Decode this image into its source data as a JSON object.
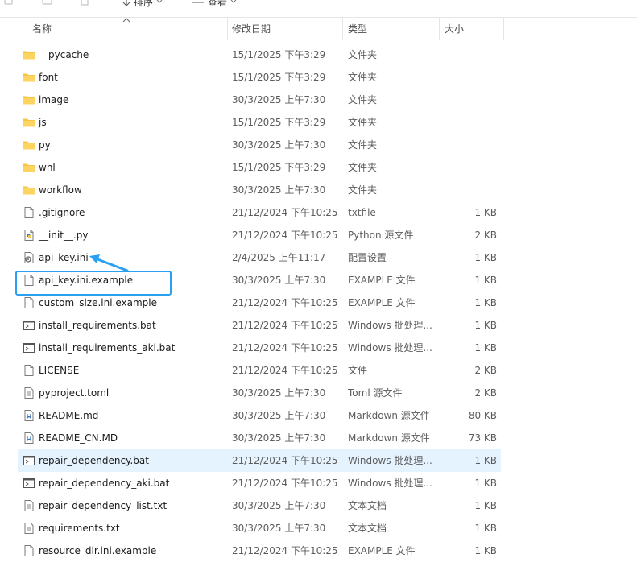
{
  "toolbar": {
    "sort_label": "排序",
    "view_label": "查看",
    "more_label": "···"
  },
  "columns": {
    "name": "名称",
    "date": "修改日期",
    "type": "类型",
    "size": "大小"
  },
  "colors": {
    "folder": "#f8c542",
    "selected_row": "#e5f3ff",
    "annotation": "#2aa0f0"
  },
  "files": [
    {
      "name": "__pycache__",
      "date": "15/1/2025 下午3:29",
      "type": "文件夹",
      "size": "",
      "icon": "folder-icon"
    },
    {
      "name": "font",
      "date": "15/1/2025 下午3:29",
      "type": "文件夹",
      "size": "",
      "icon": "folder-icon"
    },
    {
      "name": "image",
      "date": "30/3/2025 上午7:30",
      "type": "文件夹",
      "size": "",
      "icon": "folder-icon"
    },
    {
      "name": "js",
      "date": "15/1/2025 下午3:29",
      "type": "文件夹",
      "size": "",
      "icon": "folder-icon"
    },
    {
      "name": "py",
      "date": "30/3/2025 上午7:30",
      "type": "文件夹",
      "size": "",
      "icon": "folder-icon"
    },
    {
      "name": "whl",
      "date": "15/1/2025 下午3:29",
      "type": "文件夹",
      "size": "",
      "icon": "folder-icon"
    },
    {
      "name": "workflow",
      "date": "30/3/2025 上午7:30",
      "type": "文件夹",
      "size": "",
      "icon": "folder-icon"
    },
    {
      "name": ".gitignore",
      "date": "21/12/2024 下午10:25",
      "type": "txtfile",
      "size": "1 KB",
      "icon": "blank-file-icon"
    },
    {
      "name": "__init__.py",
      "date": "21/12/2024 下午10:25",
      "type": "Python 源文件",
      "size": "2 KB",
      "icon": "python-file-icon"
    },
    {
      "name": "api_key.ini",
      "date": "2/4/2025 上午11:17",
      "type": "配置设置",
      "size": "1 KB",
      "icon": "config-file-icon"
    },
    {
      "name": "api_key.ini.example",
      "date": "30/3/2025 上午7:30",
      "type": "EXAMPLE 文件",
      "size": "1 KB",
      "icon": "blank-file-icon"
    },
    {
      "name": "custom_size.ini.example",
      "date": "21/12/2024 下午10:25",
      "type": "EXAMPLE 文件",
      "size": "1 KB",
      "icon": "blank-file-icon"
    },
    {
      "name": "install_requirements.bat",
      "date": "21/12/2024 下午10:25",
      "type": "Windows 批处理...",
      "size": "1 KB",
      "icon": "batch-file-icon"
    },
    {
      "name": "install_requirements_aki.bat",
      "date": "21/12/2024 下午10:25",
      "type": "Windows 批处理...",
      "size": "1 KB",
      "icon": "batch-file-icon"
    },
    {
      "name": "LICENSE",
      "date": "21/12/2024 下午10:25",
      "type": "文件",
      "size": "2 KB",
      "icon": "blank-file-icon"
    },
    {
      "name": "pyproject.toml",
      "date": "30/3/2025 上午7:30",
      "type": "Toml 源文件",
      "size": "2 KB",
      "icon": "text-file-icon"
    },
    {
      "name": "README.md",
      "date": "30/3/2025 上午7:30",
      "type": "Markdown 源文件",
      "size": "80 KB",
      "icon": "markdown-file-icon"
    },
    {
      "name": "README_CN.MD",
      "date": "30/3/2025 上午7:30",
      "type": "Markdown 源文件",
      "size": "73 KB",
      "icon": "markdown-file-icon"
    },
    {
      "name": "repair_dependency.bat",
      "date": "21/12/2024 下午10:25",
      "type": "Windows 批处理...",
      "size": "1 KB",
      "icon": "batch-file-icon",
      "selected": true
    },
    {
      "name": "repair_dependency_aki.bat",
      "date": "21/12/2024 下午10:25",
      "type": "Windows 批处理...",
      "size": "1 KB",
      "icon": "batch-file-icon"
    },
    {
      "name": "repair_dependency_list.txt",
      "date": "30/3/2025 上午7:30",
      "type": "文本文档",
      "size": "1 KB",
      "icon": "text-file-icon"
    },
    {
      "name": "requirements.txt",
      "date": "30/3/2025 上午7:30",
      "type": "文本文档",
      "size": "1 KB",
      "icon": "text-file-icon"
    },
    {
      "name": "resource_dir.ini.example",
      "date": "21/12/2024 下午10:25",
      "type": "EXAMPLE 文件",
      "size": "1 KB",
      "icon": "blank-file-icon"
    }
  ]
}
